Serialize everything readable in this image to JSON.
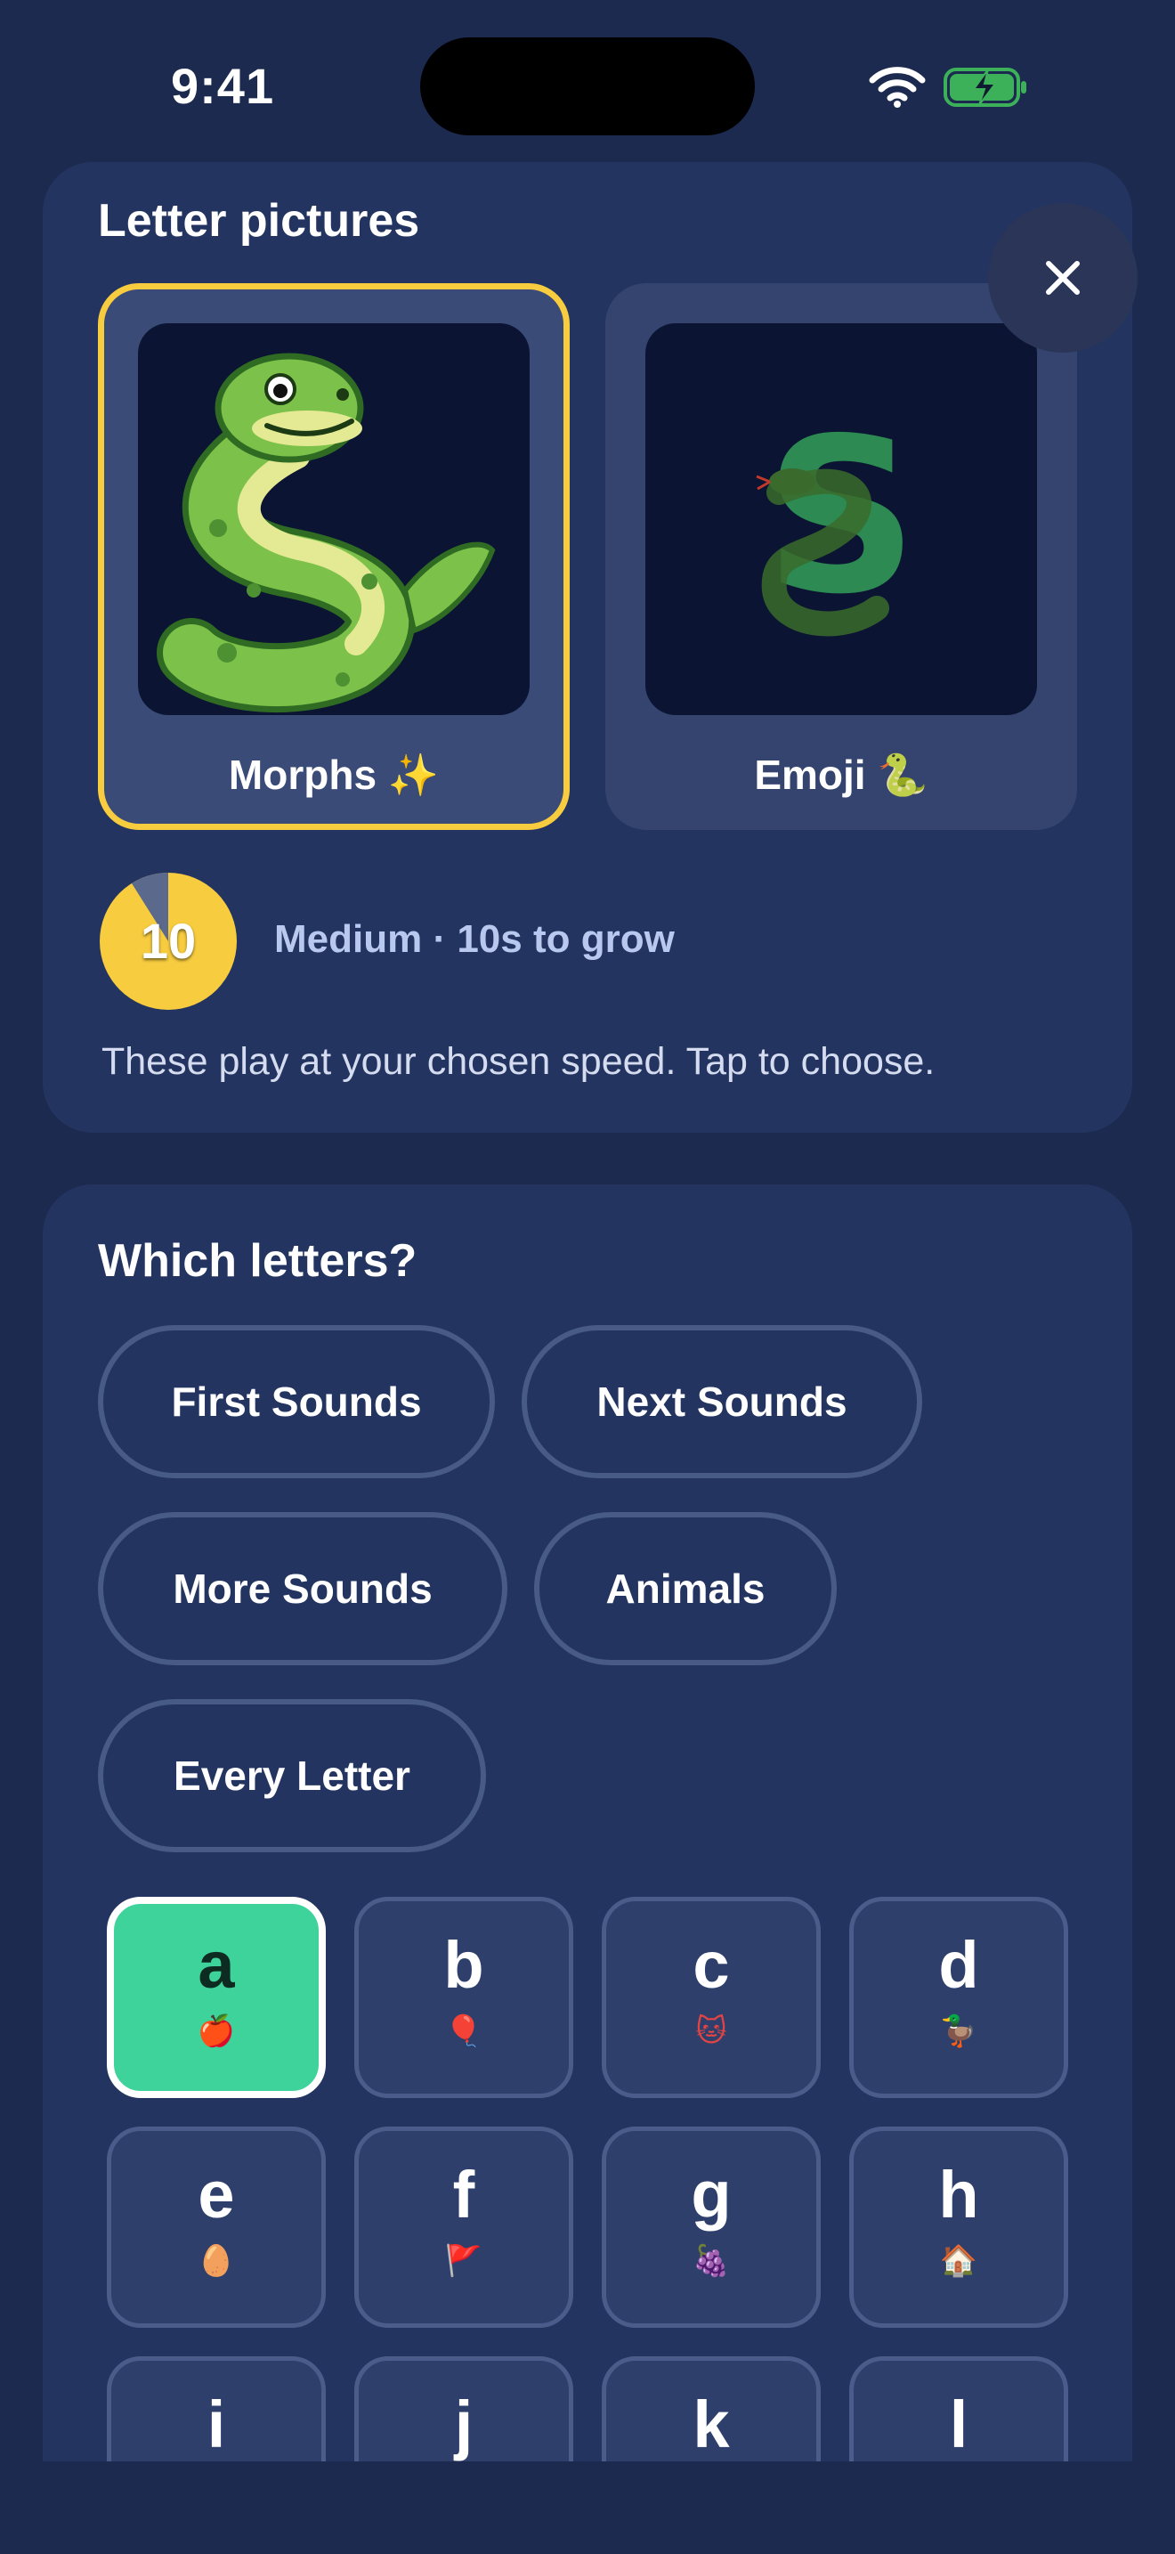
{
  "status_bar": {
    "time": "9:41"
  },
  "letter_pictures": {
    "title": "Letter pictures",
    "options": [
      {
        "label": "Morphs ✨",
        "selected": true
      },
      {
        "label": "Emoji 🐍",
        "selected": false
      }
    ],
    "speed": {
      "value": "10",
      "label": "Medium · 10s to grow"
    },
    "hint": "These play at your chosen speed. Tap to choose."
  },
  "close_icon": "close-icon",
  "which_letters": {
    "title": "Which letters?",
    "groups": [
      "First Sounds",
      "Next Sounds",
      "More Sounds",
      "Animals",
      "Every Letter"
    ],
    "letters": [
      {
        "char": "a",
        "emoji": "🍎",
        "selected": true
      },
      {
        "char": "b",
        "emoji": "🎈",
        "selected": false
      },
      {
        "char": "c",
        "emoji": "🐱",
        "selected": false
      },
      {
        "char": "d",
        "emoji": "🦆",
        "selected": false
      },
      {
        "char": "e",
        "emoji": "🥚",
        "selected": false
      },
      {
        "char": "f",
        "emoji": "🚩",
        "selected": false
      },
      {
        "char": "g",
        "emoji": "🍇",
        "selected": false
      },
      {
        "char": "h",
        "emoji": "🏠",
        "selected": false
      },
      {
        "char": "i",
        "emoji": "",
        "selected": false
      },
      {
        "char": "j",
        "emoji": "",
        "selected": false
      },
      {
        "char": "k",
        "emoji": "",
        "selected": false
      },
      {
        "char": "l",
        "emoji": "",
        "selected": false
      }
    ]
  },
  "colors": {
    "background": "#1b2a4e",
    "card": "#233460",
    "selected_outline": "#f7cc3f",
    "selected_tile": "#3dd39b"
  }
}
